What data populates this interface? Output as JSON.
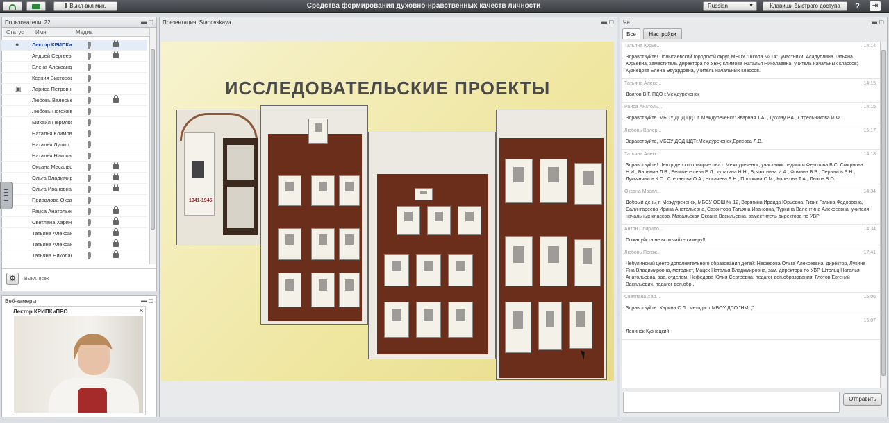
{
  "topbar": {
    "mic_button": "Выкл-вкл мик.",
    "title": "Средства формирования духовно-нравственных качеств личности",
    "language": "Russian",
    "hotkeys_button": "Клавиши быстрого доступа",
    "help": "?"
  },
  "users": {
    "title": "Пользователи: 22",
    "col_status": "Статус",
    "col_name": "Имя",
    "col_media": "Медиа",
    "footer_label": "Выкл. всех",
    "list": [
      {
        "name": "Лектор КРИПКиПРО",
        "status": "presenter",
        "mic": true,
        "lock": true,
        "selected": true
      },
      {
        "name": "Андрей Сергеевич",
        "status": "",
        "mic": true,
        "lock": true
      },
      {
        "name": "Елена Александровна",
        "status": "",
        "mic": true,
        "lock": false
      },
      {
        "name": "Ксения Викторовна",
        "status": "",
        "mic": true,
        "lock": false
      },
      {
        "name": "Лариса Петровна",
        "status": "hand",
        "mic": true,
        "lock": false
      },
      {
        "name": "Любовь Валерьевна",
        "status": "",
        "mic": true,
        "lock": true
      },
      {
        "name": "Любовь Погожева",
        "status": "",
        "mic": true,
        "lock": false
      },
      {
        "name": "Михаил Пермяков",
        "status": "",
        "mic": true,
        "lock": false
      },
      {
        "name": "Наталья Климова",
        "status": "",
        "mic": true,
        "lock": false
      },
      {
        "name": "Наталья Лушко",
        "status": "",
        "mic": true,
        "lock": false
      },
      {
        "name": "Наталья Николаевна",
        "status": "",
        "mic": true,
        "lock": false
      },
      {
        "name": "Оксана Масальская",
        "status": "",
        "mic": true,
        "lock": true
      },
      {
        "name": "Ольга Владимировна",
        "status": "",
        "mic": true,
        "lock": true
      },
      {
        "name": "Ольга Ивановна",
        "status": "",
        "mic": true,
        "lock": true
      },
      {
        "name": "Привалова Оксана",
        "status": "",
        "mic": true,
        "lock": false
      },
      {
        "name": "Раиса Анатольевна",
        "status": "",
        "mic": true,
        "lock": true
      },
      {
        "name": "Светлана Харина",
        "status": "",
        "mic": true,
        "lock": true
      },
      {
        "name": "Татьяна Александровна",
        "status": "",
        "mic": true,
        "lock": true
      },
      {
        "name": "Татьяна Александровна",
        "status": "",
        "mic": true,
        "lock": true
      },
      {
        "name": "Татьяна Николаевна",
        "status": "",
        "mic": true,
        "lock": true
      }
    ]
  },
  "presentation": {
    "header": "Презентация: Stahovskaya",
    "slide_title": "ИССЛЕДОВАТЕЛЬСКИЕ ПРОЕКТЫ"
  },
  "webcams": {
    "header": "Веб-камеры",
    "name": "Лектор КРИПКиПРО"
  },
  "chat": {
    "header": "Чат",
    "tab_all": "Все",
    "tab_settings": "Настройки",
    "send_label": "Отправить",
    "messages": [
      {
        "who": "Татьяна Юрье...",
        "time": "14:14",
        "text": "Здравствуйте! Полысаевский городской округ, МБОУ \"Школа № 14\", участники: Асадуллина Татьяна Юрьевна, заместитель директора по УВР; Климова Наталья Николаевна, учитель начальных классов; Кузнецова Елена Эдуардовна, учитель начальных классов."
      },
      {
        "who": "Татьяна Алекс...",
        "time": "14:15",
        "text": "Долгов В.Г. ПДО г.Междуреченск"
      },
      {
        "who": "Раиса Анатоль...",
        "time": "14:15",
        "text": "Здравствуйте. МБОУ ДОД ЦДТ г. Междуреченск: Зварная Т.А. , Дуклау Р.А., Стрельникова И.Ф."
      },
      {
        "who": "Любовь Валер...",
        "time": "15:17",
        "text": "Здравствуйте, МБОУ ДОД ЦДТг.Междуреченск,Ерисова Л.В."
      },
      {
        "who": "Татьяна Алекс...",
        "time": "14:18",
        "text": "Здравствуйте! Центр детского творчества г. Междуреченск, участники:педагоги Федотова В.С. Смирнова Н.И., Бальман Л.В., Бельчегешева Е.Л., кулагина Н.Н., Бряхотнина И.А., Фомина Б.В., Перваков Е.Н., Лукьянчиков К.С., Степанова О.А., Носачева Е.Н., Плоскина С.М., Колегова Т.А., Пыхов В.О."
      },
      {
        "who": "Оксана Масал...",
        "time": "14:34",
        "text": "Добрый день, г. Междуреченск, МБОУ ООШ № 12, Варягина Ираида Юрьевна, Гизик Галина Федоровна, Салингареева Ирина Анатольевна, Сазонтова Татьяна Ивановна, Туркина Валентина Алексеевна, учителя начальных классов, Масальская Оксана Васильевна, заместитель директора по УВР"
      },
      {
        "who": "Антон Спиридо...",
        "time": "14:34",
        "text": "Пожалуйста не включайте камеру!!"
      },
      {
        "who": "Любовь Погож...",
        "time": "17:41",
        "text": "Чебулинский центр дополнительного образования детей: Нефедова Ольга Алексеевна, директор, Лукина Яна Владимировна, методист, Мацек Наталья Владимировна, зам. директора по УВР, Штольц Наталья Анатольевна, зав. отделом. Нефедова Юлия Сергеевна, педагог доп.образования, Глотов Евгений Васильевич, педагог доп.обр.."
      },
      {
        "who": "Светлана Хар...",
        "time": "15:06",
        "text": "Здравствуйте. Харина С.Л.. методист МБОУ ДПО \"НМЦ\""
      },
      {
        "who": "",
        "time": "15:07",
        "text": "Ленинск-Кузнецкий"
      }
    ]
  },
  "colors": {
    "accent": "#1a3d8f",
    "topbar": "#45484d",
    "slide_bg": "#efe6a0",
    "shelf": "#6b2e1b"
  }
}
